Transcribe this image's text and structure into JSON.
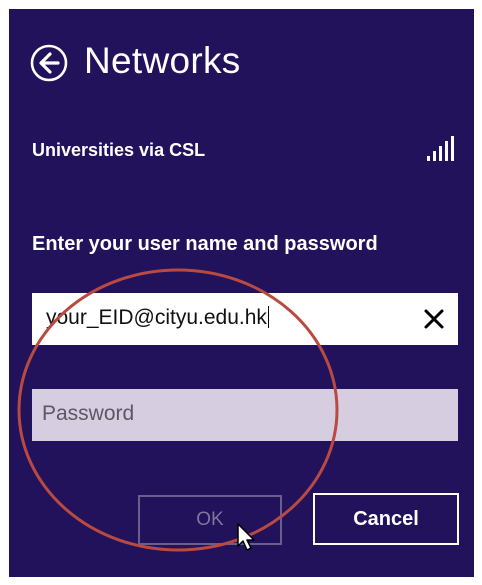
{
  "header": {
    "title": "Networks",
    "back_icon": "back-arrow-circle-icon"
  },
  "network": {
    "name": "Universities via CSL",
    "signal_icon": "wifi-signal-icon"
  },
  "form": {
    "prompt": "Enter your user name and password",
    "username_value": "your_EID@cityu.edu.hk",
    "password_placeholder": "Password",
    "clear_icon": "close-x-icon"
  },
  "buttons": {
    "ok_label": "OK",
    "cancel_label": "Cancel"
  },
  "colors": {
    "background": "#22125b",
    "field": "#ffffff",
    "field_disabled": "#d6cde0",
    "annotation": "#b84a42"
  }
}
